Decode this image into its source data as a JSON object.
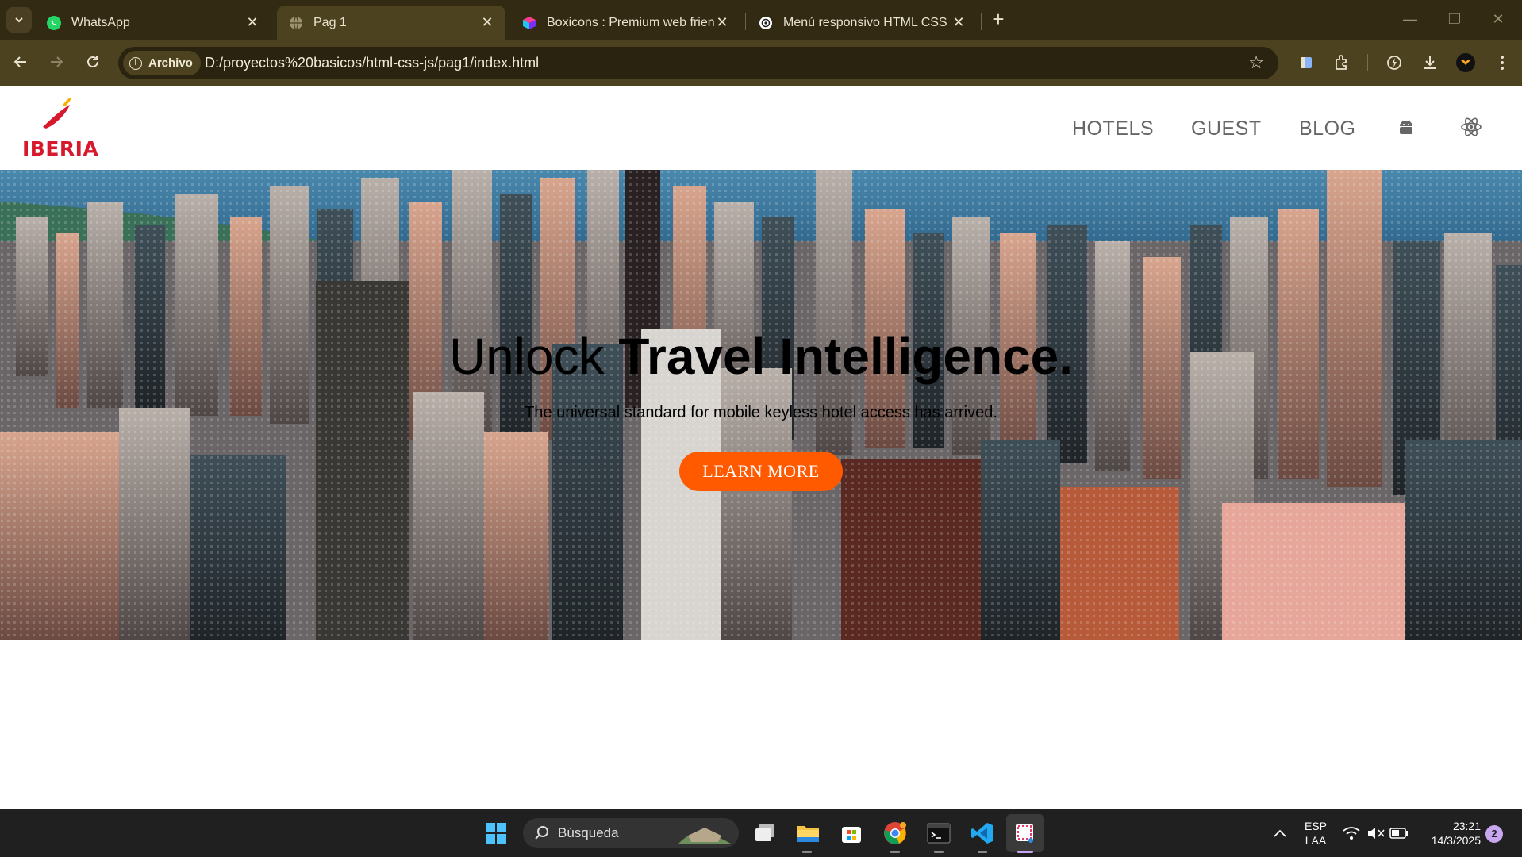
{
  "browser": {
    "tabs": [
      {
        "title": "WhatsApp",
        "favicon": "whatsapp-icon",
        "active": false
      },
      {
        "title": "Pag 1",
        "favicon": "globe-icon",
        "active": true
      },
      {
        "title": "Boxicons : Premium web friendly",
        "favicon": "boxicons-icon",
        "active": false
      },
      {
        "title": "Menú responsivo HTML CSS JS",
        "favicon": "openai-icon",
        "active": false
      }
    ],
    "security_chip": "Archivo",
    "url": "D:/proyectos%20basicos/html-css-js/pag1/index.html"
  },
  "site": {
    "logo_text": "IBERIA",
    "nav": [
      "HOTELS",
      "GUEST",
      "BLOG"
    ],
    "nav_icons": [
      "android-icon",
      "react-icon"
    ],
    "hero": {
      "title_light": "Unlock ",
      "title_bold": "Travel Intelligence.",
      "subtitle": "The universal standard for mobile keyless hotel access has arrived.",
      "cta": "LEARN MORE"
    },
    "colors": {
      "brand_red": "#d7192d",
      "cta_orange": "#ff5a00"
    }
  },
  "taskbar": {
    "search_placeholder": "Búsqueda",
    "language": "ESP",
    "layout": "LAA",
    "time": "23:21",
    "date": "14/3/2025",
    "notifications": "2"
  }
}
